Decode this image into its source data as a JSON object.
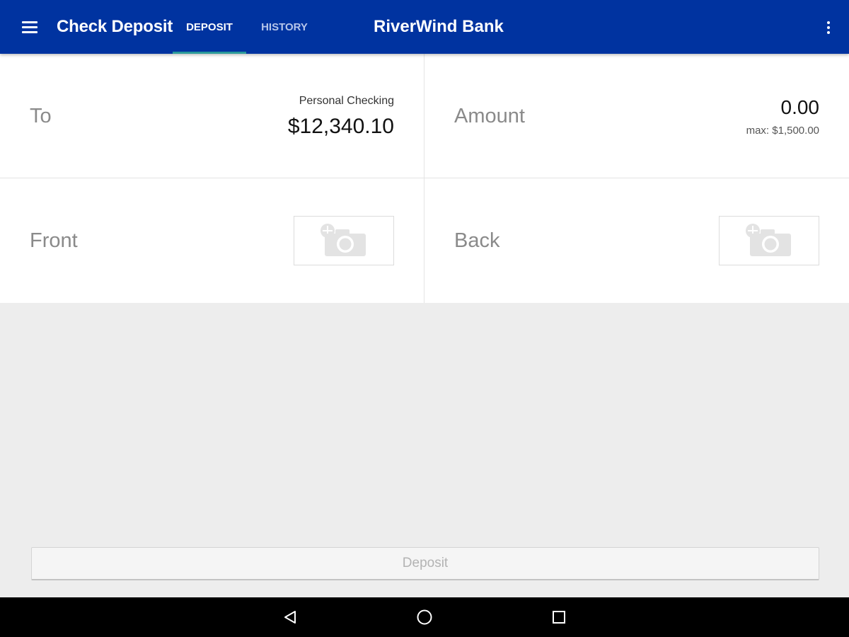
{
  "appbar": {
    "title": "Check Deposit",
    "tabs": [
      {
        "label": "DEPOSIT",
        "selected": true
      },
      {
        "label": "HISTORY",
        "selected": false
      }
    ],
    "bank_name": "RiverWind Bank",
    "menu_icon": "hamburger-menu-icon",
    "overflow_icon": "more-vert-icon"
  },
  "form": {
    "to": {
      "label": "To",
      "account_name": "Personal Checking",
      "balance": "$12,340.10"
    },
    "amount": {
      "label": "Amount",
      "value": "0.00",
      "max": "max: $1,500.00"
    },
    "front": {
      "label": "Front",
      "icon": "add-a-photo-icon"
    },
    "back": {
      "label": "Back",
      "icon": "add-a-photo-icon"
    }
  },
  "deposit_button": {
    "label": "Deposit",
    "enabled": false
  },
  "system_nav": {
    "icons": [
      "back-triangle-icon",
      "home-circle-icon",
      "recents-square-icon"
    ]
  },
  "colors": {
    "appbar": "#0033a0",
    "tab_indicator": "#2b9a9a",
    "background": "#ededed",
    "panel": "#ffffff"
  }
}
